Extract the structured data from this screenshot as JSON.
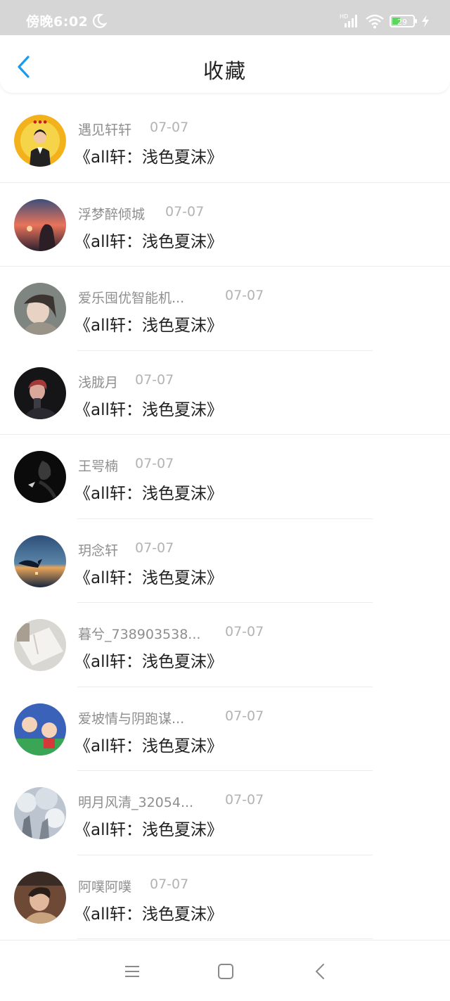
{
  "status_bar": {
    "time": "傍晚6:02",
    "battery_level": "29",
    "network_badge": "HD"
  },
  "header": {
    "title": "收藏"
  },
  "items": [
    {
      "name": "遇见轩轩",
      "date": "07-07",
      "title": "《all轩：浅色夏沫》"
    },
    {
      "name": "浮梦醉倾城",
      "date": "07-07",
      "title": "《all轩：浅色夏沫》"
    },
    {
      "name": "爱乐囤优智能机...",
      "date": "07-07",
      "title": "《all轩：浅色夏沫》"
    },
    {
      "name": "浅胧月",
      "date": "07-07",
      "title": "《all轩：浅色夏沫》"
    },
    {
      "name": "王咢楠",
      "date": "07-07",
      "title": "《all轩：浅色夏沫》"
    },
    {
      "name": "玥念轩",
      "date": "07-07",
      "title": "《all轩：浅色夏沫》"
    },
    {
      "name": "暮兮_738903538...",
      "date": "07-07",
      "title": "《all轩：浅色夏沫》"
    },
    {
      "name": "爱坡情与阴跑谋...",
      "date": "07-07",
      "title": "《all轩：浅色夏沫》"
    },
    {
      "name": "明月风清_32054...",
      "date": "07-07",
      "title": "《all轩：浅色夏沫》"
    },
    {
      "name": "阿噗阿噗",
      "date": "07-07",
      "title": "《all轩：浅色夏沫》"
    }
  ],
  "colors": {
    "accent": "#1a9bf0",
    "status_bar_bg": "#d6d6d6",
    "name_text": "#8e8e8e",
    "date_text": "#b3b3b3"
  }
}
